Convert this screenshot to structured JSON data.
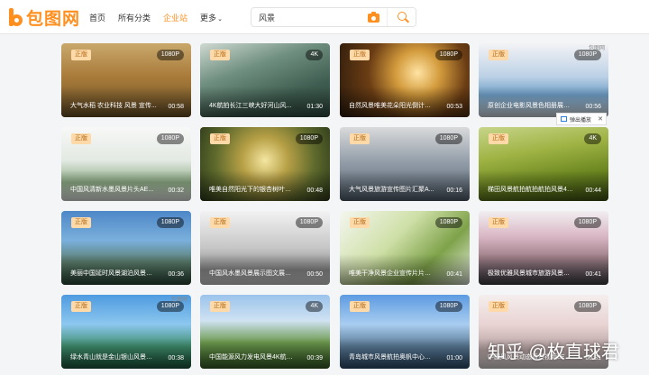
{
  "header": {
    "logo_text": "包图网",
    "nav": [
      "首页",
      "所有分类",
      "企业站",
      "更多"
    ],
    "active_nav": 2,
    "search_value": "风景"
  },
  "popout_label": "弹出播放",
  "watermark": "知乎 @枚直球君",
  "cards": [
    {
      "tag": "正版",
      "res": "1080P",
      "title": "大气水稻 农业科技 风景 宣传...",
      "dur": "00:58",
      "bg": "linear-gradient(180deg,#c9a86c 0%,#a97b3a 45%,#6b5128 100%)"
    },
    {
      "tag": "正版",
      "res": "4K",
      "title": "4K航拍长江三峡大好河山风...",
      "dur": "01:30",
      "bg": "linear-gradient(160deg,#cfd9d2 0%,#6f8f80 35%,#3e5c4f 70%,#2f4a40 100%)"
    },
    {
      "tag": "正版",
      "res": "1080P",
      "title": "自然风景唯美花朵阳光倒计时...",
      "dur": "00:53",
      "bg": "radial-gradient(circle at 60% 40%,#ffe3a3 0%,#d39b3c 25%,#6b3d14 55%,#2a1a0c 100%)"
    },
    {
      "tag": "正版",
      "res": "1080P",
      "title": "原创企业电影风景色相册展示...",
      "dur": "00:56",
      "bg": "linear-gradient(180deg,#f3f3f5 0%,#bcd1e6 45%,#6fa0c8 70%,#d9e3ea 100%)",
      "small": "包图网"
    },
    {
      "tag": "正版",
      "res": "1080P",
      "title": "中国风清新水墨风景片头AE...",
      "dur": "00:32",
      "bg": "linear-gradient(180deg,#f7f8f7 0%,#e3e9e3 45%,#8fae86 75%,#f1f3f1 100%)"
    },
    {
      "tag": "正版",
      "res": "1080P",
      "title": "唯美自然阳光下的银杏树叶秋...",
      "dur": "00:48",
      "bg": "radial-gradient(circle at 50% 45%,#f4e6a1 0%,#b7a046 30%,#5e6a2c 65%,#2d3a1a 100%)"
    },
    {
      "tag": "正版",
      "res": "1080P",
      "title": "大气风景旅游宣传图片汇聚A...",
      "dur": "00:16",
      "bg": "linear-gradient(180deg,#d9dadb 0%,#8f9aa6 50%,#53606c 100%)"
    },
    {
      "tag": "正版",
      "res": "4K",
      "title": "梯田风景航拍航拍航拍风景4K...",
      "dur": "00:44",
      "bg": "linear-gradient(170deg,#c7d58a 0%,#9fb344 35%,#6f8a22 65%,#3f5412 100%)"
    },
    {
      "tag": "正版",
      "res": "1080P",
      "title": "美丽中国延时风景湖泊风景区...",
      "dur": "00:36",
      "bg": "linear-gradient(180deg,#4d87c7 0%,#7ab0dc 40%,#5a7b6a 70%,#2c4a3a 100%)"
    },
    {
      "tag": "正版",
      "res": "1080P",
      "title": "中国风水墨风景展示图文展示...",
      "dur": "00:50",
      "bg": "linear-gradient(180deg,#f2f2f2 0%,#c6c6c6 50%,#8b8b8b 80%,#dcdcdc 100%)"
    },
    {
      "tag": "正版",
      "res": "1080P",
      "title": "唯美干净风景企业宣传片片头...",
      "dur": "00:41",
      "bg": "linear-gradient(135deg,#f4f6ef 0%,#cfe0a8 40%,#7ea24a 70%,#e8efe0 100%)"
    },
    {
      "tag": "正版",
      "res": "1080P",
      "title": "极致优雅风景城市旅游风景图...",
      "dur": "00:41",
      "bg": "linear-gradient(180deg,#f1eef0 0%,#d9b6c4 35%,#9a7b84 65%,#3d3f45 100%)"
    },
    {
      "tag": "正版",
      "res": "1080P",
      "title": "绿水青山就是金山银山风景风...",
      "dur": "00:38",
      "bg": "linear-gradient(180deg,#4e9be0 0%,#8cc7ef 40%,#3f8f6e 70%,#1d5a3f 100%)",
      "small": "包图网"
    },
    {
      "tag": "正版",
      "res": "4K",
      "title": "中国能源风力发电风景4K航拍...",
      "dur": "00:39",
      "bg": "linear-gradient(180deg,#9bc3ec 0%,#cfe2f2 35%,#6d9a4e 65%,#355e26 100%)"
    },
    {
      "tag": "正版",
      "res": "1080P",
      "title": "青岛城市风景航拍奥帆中心视...",
      "dur": "01:00",
      "bg": "linear-gradient(180deg,#5d9be2 0%,#a9cdf0 40%,#5a7a96 70%,#2f4f6d 100%)"
    },
    {
      "tag": "正版",
      "res": "1080P",
      "title": "中国风风景动态背景视频LED...",
      "dur": "00:31",
      "bg": "linear-gradient(180deg,#f5eeee 0%,#e9d3d3 40%,#b7a3a3 75%,#e6dede 100%)"
    }
  ]
}
